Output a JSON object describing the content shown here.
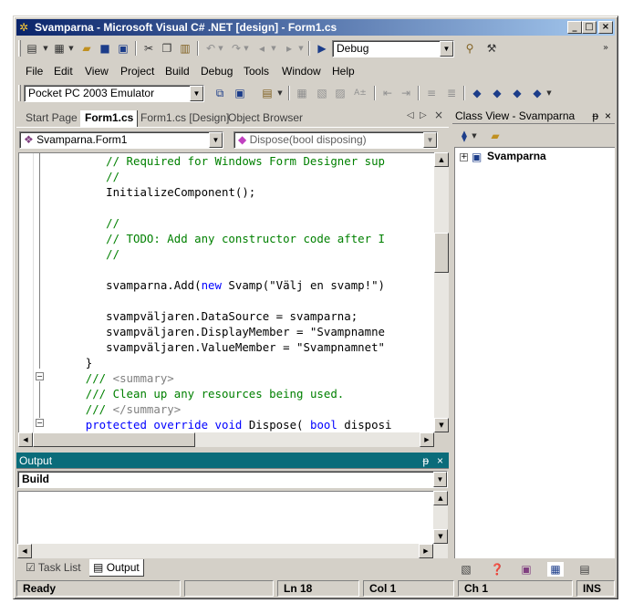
{
  "window": {
    "title": "Svamparna - Microsoft Visual C# .NET [design] - Form1.cs",
    "controls": {
      "minimize": "_",
      "maximize": "□",
      "close": "×"
    }
  },
  "toolbar1": {
    "config_value": "Debug"
  },
  "menu": [
    "File",
    "Edit",
    "View",
    "Project",
    "Build",
    "Debug",
    "Tools",
    "Window",
    "Help"
  ],
  "toolbar2": {
    "device_value": "Pocket PC 2003 Emulator"
  },
  "doc_tabs": [
    "Start Page",
    "Form1.cs",
    "Form1.cs [Design]",
    "Object Browser"
  ],
  "active_tab": "Form1.cs",
  "editor": {
    "type_combo": "Svamparna.Form1",
    "member_combo": "Dispose(bool disposing)",
    "lines": [
      {
        "indent": "         ",
        "segs": [
          {
            "t": "// Required for Windows Form Designer sup",
            "c": "c"
          }
        ]
      },
      {
        "indent": "         ",
        "segs": [
          {
            "t": "//",
            "c": "c"
          }
        ]
      },
      {
        "indent": "         ",
        "segs": [
          {
            "t": "InitializeComponent();",
            "c": ""
          }
        ]
      },
      {
        "indent": "",
        "segs": []
      },
      {
        "indent": "         ",
        "segs": [
          {
            "t": "//",
            "c": "c"
          }
        ]
      },
      {
        "indent": "         ",
        "segs": [
          {
            "t": "// TODO: Add any constructor code after I",
            "c": "c"
          }
        ]
      },
      {
        "indent": "         ",
        "segs": [
          {
            "t": "//",
            "c": "c"
          }
        ]
      },
      {
        "indent": "",
        "segs": []
      },
      {
        "indent": "         ",
        "segs": [
          {
            "t": "svamparna.Add(",
            "c": ""
          },
          {
            "t": "new",
            "c": "k"
          },
          {
            "t": " Svamp(\"Välj en svamp!\")",
            "c": ""
          }
        ]
      },
      {
        "indent": "",
        "segs": []
      },
      {
        "indent": "         ",
        "segs": [
          {
            "t": "svampväljaren.DataSource = svamparna;",
            "c": ""
          }
        ]
      },
      {
        "indent": "         ",
        "segs": [
          {
            "t": "svampväljaren.DisplayMember = \"Svampnamne",
            "c": ""
          }
        ]
      },
      {
        "indent": "         ",
        "segs": [
          {
            "t": "svampväljaren.ValueMember = \"Svampnamnet\"",
            "c": ""
          }
        ]
      },
      {
        "indent": "      ",
        "segs": [
          {
            "t": "}",
            "c": ""
          }
        ]
      },
      {
        "indent": "      ",
        "segs": [
          {
            "t": "/// ",
            "c": "c"
          },
          {
            "t": "<summary>",
            "c": "g"
          }
        ]
      },
      {
        "indent": "      ",
        "segs": [
          {
            "t": "/// Clean up any resources being used.",
            "c": "c"
          }
        ]
      },
      {
        "indent": "      ",
        "segs": [
          {
            "t": "/// ",
            "c": "c"
          },
          {
            "t": "</summary>",
            "c": "g"
          }
        ]
      },
      {
        "indent": "      ",
        "segs": [
          {
            "t": "protected",
            "c": "k"
          },
          {
            "t": " ",
            "c": ""
          },
          {
            "t": "override",
            "c": "k"
          },
          {
            "t": " ",
            "c": ""
          },
          {
            "t": "void",
            "c": "k"
          },
          {
            "t": " Dispose( ",
            "c": ""
          },
          {
            "t": "bool",
            "c": "k"
          },
          {
            "t": " disposi",
            "c": ""
          }
        ]
      }
    ]
  },
  "class_view": {
    "title": "Class View - Svamparna",
    "tree_root": "Svamparna",
    "expander": "+"
  },
  "output": {
    "title": "Output",
    "pane_value": "Build"
  },
  "bottom_tabs": [
    "Task List",
    "Output"
  ],
  "status": {
    "message": "Ready",
    "line": "Ln 18",
    "col": "Col 1",
    "ch": "Ch 1",
    "mode": "INS"
  },
  "pane_glyphs": {
    "pin": "ᵽ",
    "close": "×",
    "left": "◁",
    "right": "▷"
  },
  "colors": {
    "title_start": "#0a246a",
    "title_end": "#a6caf0",
    "output_title": "#0a6c7a",
    "comment": "#008000",
    "keyword": "#0000ff"
  }
}
